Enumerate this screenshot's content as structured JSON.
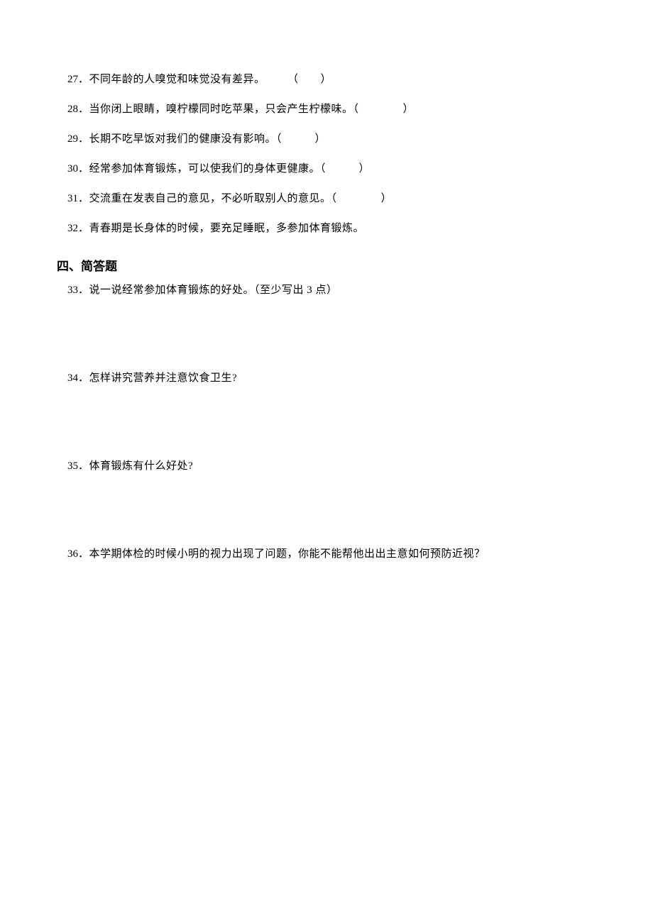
{
  "questions_tf": [
    {
      "num": "27",
      "text": "．不同年龄的人嗅觉和味觉没有差异。　　　（　　）"
    },
    {
      "num": "28",
      "text": "．当你闭上眼睛，嗅柠檬同时吃苹果，只会产生柠檬味。（　　　　）"
    },
    {
      "num": "29",
      "text": "．长期不吃早饭对我们的健康没有影响。（　　　）"
    },
    {
      "num": "30",
      "text": "．经常参加体育锻炼，可以使我们的身体更健康。（　　　）"
    },
    {
      "num": "31",
      "text": "．交流重在发表自己的意见，不必听取别人的意见。（　　　　）"
    },
    {
      "num": "32",
      "text": "．青春期是长身体的时候，要充足睡眠，多参加体育锻炼。"
    }
  ],
  "section4": {
    "title": "四、简答题",
    "items": [
      {
        "num": "33",
        "text": "．说一说经常参加体育锻炼的好处。（至少写出 3 点）"
      },
      {
        "num": "34",
        "text": "．怎样讲究营养并注意饮食卫生?"
      },
      {
        "num": "35",
        "text": "．体育锻炼有什么好处?"
      },
      {
        "num": "36",
        "text": "．本学期体检的时候小明的视力出现了问题，你能不能帮他出出主意如何预防近视？"
      }
    ]
  }
}
